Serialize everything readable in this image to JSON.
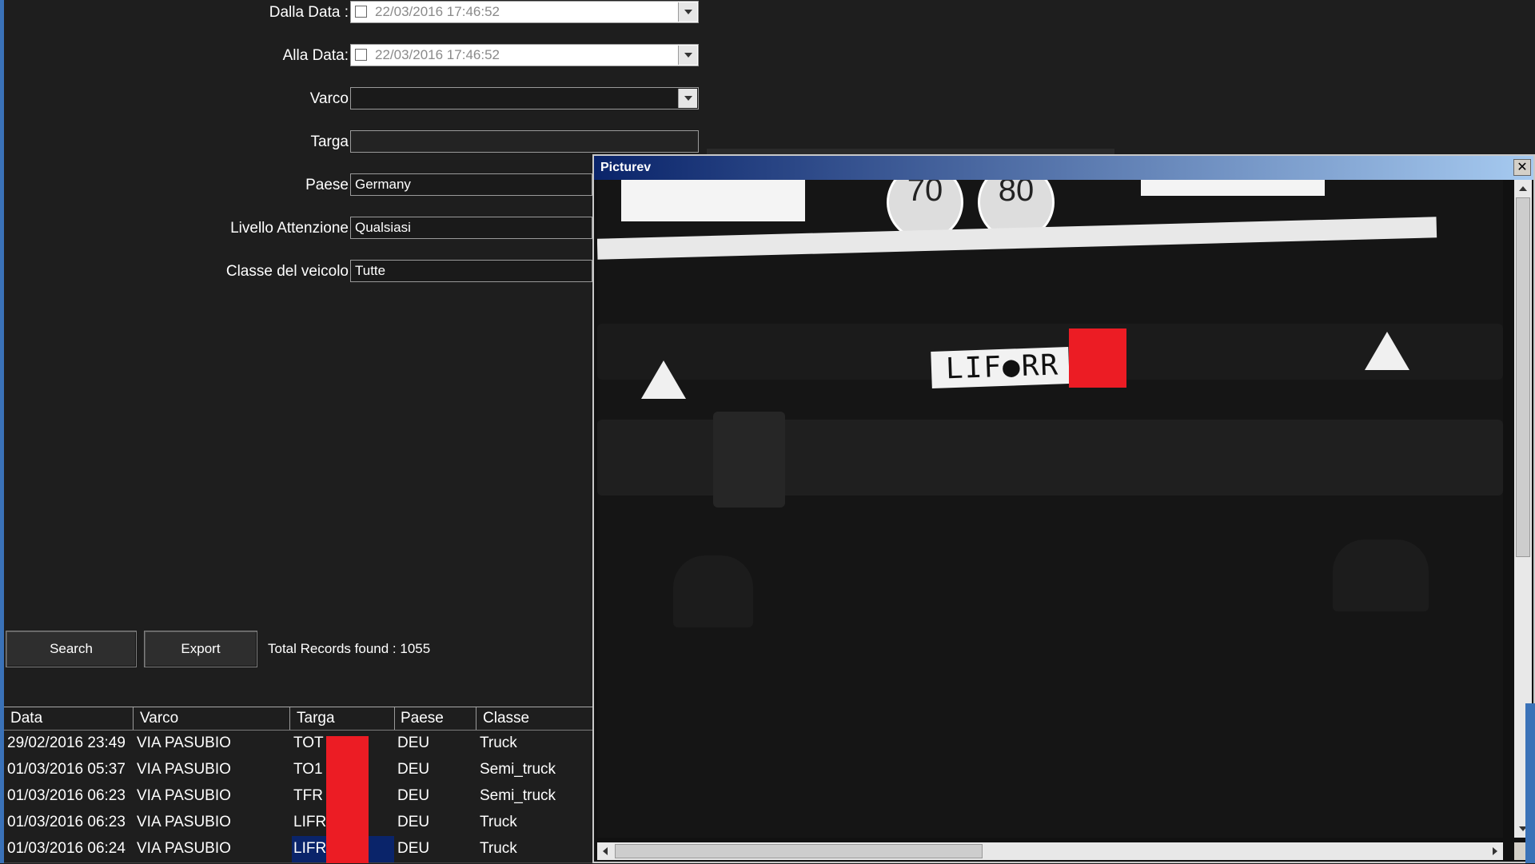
{
  "form": {
    "dalla_data_label": "Dalla Data :",
    "dalla_data_value": "22/03/2016 17:46:52",
    "alla_data_label": "Alla Data:",
    "alla_data_value": "22/03/2016 17:46:52",
    "varco_label": "Varco",
    "varco_value": "",
    "targa_label": "Targa",
    "targa_value": "",
    "paese_label": "Paese",
    "paese_value": "Germany",
    "livello_label": "Livello Attenzione",
    "livello_value": "Qualsiasi",
    "classe_label": "Classe del veicolo",
    "classe_value": "Tutte"
  },
  "actions": {
    "search_label": "Search",
    "export_label": "Export",
    "total_text": "Total Records found : 1055"
  },
  "table": {
    "headers": [
      "Data",
      "Varco",
      "Targa",
      "Paese",
      "Classe"
    ],
    "rows": [
      [
        "29/02/2016 23:49",
        "VIA PASUBIO",
        "TOT",
        "DEU",
        "Truck"
      ],
      [
        "01/03/2016 05:37",
        "VIA PASUBIO",
        "TO1",
        "DEU",
        "Semi_truck"
      ],
      [
        "01/03/2016 06:23",
        "VIA PASUBIO",
        "TFR",
        "DEU",
        "Semi_truck"
      ],
      [
        "01/03/2016 06:23",
        "VIA PASUBIO",
        "LIFR",
        "DEU",
        "Truck"
      ],
      [
        "01/03/2016 06:24",
        "VIA PASUBIO",
        "LIFR",
        "DEU",
        "Truck"
      ]
    ],
    "selected_row": 4
  },
  "picture_window": {
    "title": "Picturev",
    "close_glyph": "✕",
    "plate_text": "LIF●RR",
    "dial_left": "70",
    "dial_right": "80"
  },
  "colors": {
    "background": "#1e1e1e",
    "titlebar_start": "#0a246a",
    "titlebar_end": "#a6caf0",
    "redaction": "#ec1c24",
    "selection": "#0a246a"
  }
}
